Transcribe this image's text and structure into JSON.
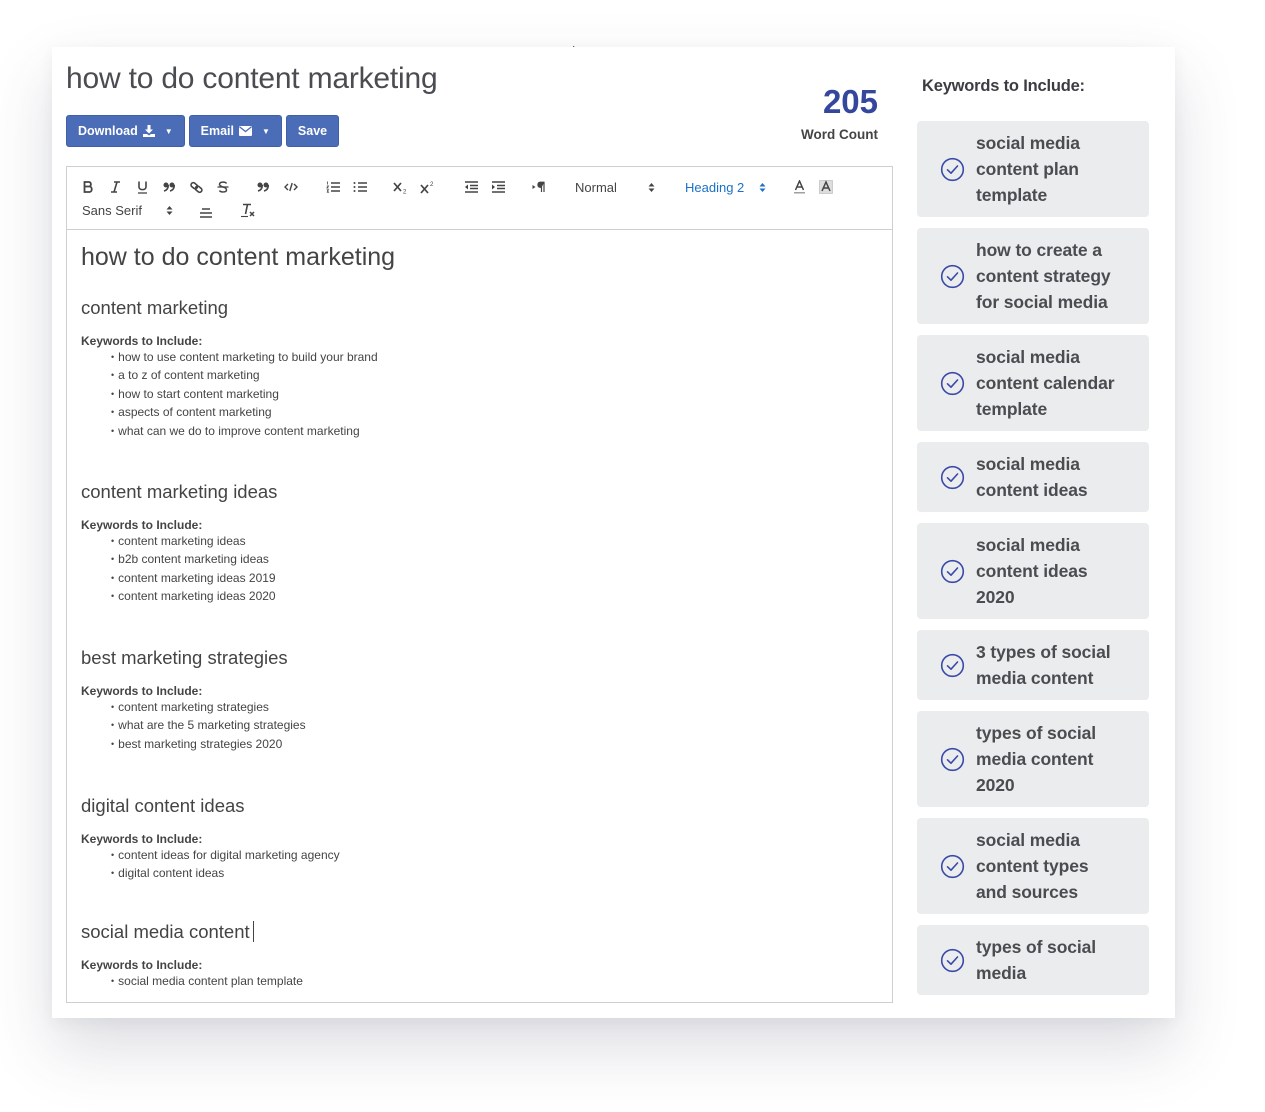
{
  "document": {
    "title": "how to do content marketing"
  },
  "actions": {
    "download_label": "Download",
    "download_icon": "download-icon",
    "email_label": "Email",
    "email_icon": "envelope-icon",
    "save_label": "Save"
  },
  "word_count": {
    "value": "205",
    "label": "Word Count"
  },
  "toolbar": {
    "buttons": [
      "bold",
      "italic",
      "underline",
      "blockquote",
      "link",
      "strikethrough",
      "quote",
      "code",
      "ordered-list",
      "bullet-list",
      "subscript",
      "superscript",
      "outdent",
      "indent",
      "text-direction",
      "font-color",
      "background-color",
      "align",
      "clear-formatting"
    ],
    "size_select": "Normal",
    "header_select": "Heading 2",
    "font_select": "Sans Serif",
    "active_color": "#1d70c8"
  },
  "editor": {
    "heading": "how to do content marketing",
    "sections": [
      {
        "heading": "content marketing",
        "keywords_label": "Keywords to Include:",
        "keywords": [
          "how to use content marketing to build your brand",
          "a to z of content marketing",
          "how to start content marketing",
          "aspects of content marketing",
          "what can we do to improve content marketing"
        ]
      },
      {
        "heading": "content marketing ideas",
        "keywords_label": "Keywords to Include:",
        "keywords": [
          "content marketing ideas",
          "b2b content marketing ideas",
          "content marketing ideas 2019",
          "content marketing ideas 2020"
        ]
      },
      {
        "heading": "best marketing strategies",
        "keywords_label": "Keywords to Include:",
        "keywords": [
          "content marketing strategies",
          "what are the 5 marketing strategies",
          "best marketing strategies 2020"
        ]
      },
      {
        "heading": "digital content ideas",
        "keywords_label": "Keywords to Include:",
        "keywords": [
          "content ideas for digital marketing agency",
          "digital content ideas"
        ]
      },
      {
        "heading": "social media content",
        "keywords_label": "Keywords to Include:",
        "keywords": [
          "social media content plan template"
        ]
      }
    ]
  },
  "sidebar": {
    "title": "Keywords to Include:",
    "check_icon": "check-circle-icon",
    "accent_color": "#3a4aa8",
    "keywords": [
      {
        "lines": [
          "social media",
          "content plan",
          "template"
        ],
        "checked": true
      },
      {
        "lines": [
          "how to create a",
          "content strategy",
          "for social media"
        ],
        "checked": true
      },
      {
        "lines": [
          "social media",
          "content calendar",
          "template"
        ],
        "checked": true
      },
      {
        "lines": [
          "social media",
          "content ideas"
        ],
        "checked": true
      },
      {
        "lines": [
          "social media",
          "content ideas",
          "2020"
        ],
        "checked": true
      },
      {
        "lines": [
          "3 types of social",
          "media content"
        ],
        "checked": true
      },
      {
        "lines": [
          "types of social",
          "media content",
          "2020"
        ],
        "checked": true
      },
      {
        "lines": [
          "social media",
          "content types",
          "and sources"
        ],
        "checked": true
      },
      {
        "lines": [
          "types of social",
          "media"
        ],
        "checked": true
      }
    ]
  }
}
